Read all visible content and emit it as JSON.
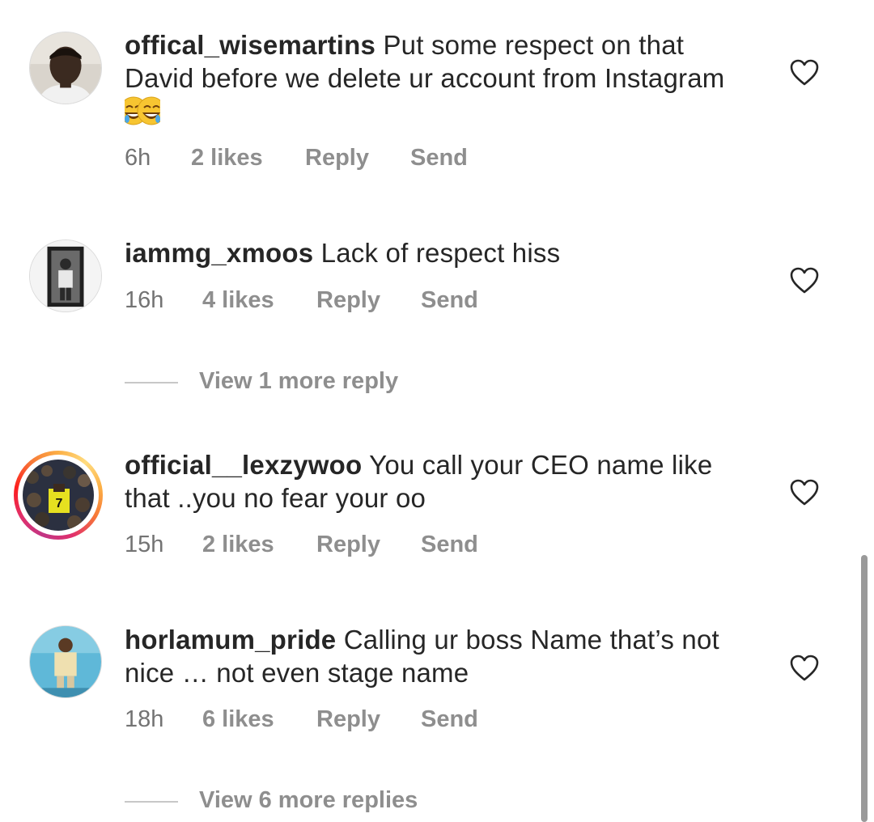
{
  "comments": [
    {
      "username": "offical_wisemartins",
      "text": "Put some respect on that David before we delete ur account from Instagram",
      "emoji": "😂😂",
      "time": "6h",
      "likes": "2 likes",
      "reply": "Reply",
      "send": "Send",
      "avatar_icon": "profile-photo-man",
      "has_story_ring": false
    },
    {
      "username": "iammg_xmoos",
      "text": "Lack of respect hiss",
      "time": "16h",
      "likes": "4 likes",
      "reply": "Reply",
      "send": "Send",
      "avatar_icon": "profile-photo-mirror-selfie",
      "has_story_ring": false,
      "view_replies": "View 1 more reply"
    },
    {
      "username": "official__lexzywoo",
      "text": "You call your CEO name like that ..you no fear your oo",
      "time": "15h",
      "likes": "2 likes",
      "reply": "Reply",
      "send": "Send",
      "avatar_icon": "profile-photo-crowd-jersey",
      "has_story_ring": true
    },
    {
      "username": "horlamum_pride",
      "text": "Calling ur boss Name that’s not nice … not even stage name",
      "time": "18h",
      "likes": "6 likes",
      "reply": "Reply",
      "send": "Send",
      "avatar_icon": "profile-photo-man-standing",
      "has_story_ring": false,
      "view_replies": "View 6 more replies"
    }
  ],
  "colors": {
    "text_primary": "#262626",
    "text_secondary": "#8e8e8e",
    "background": "#ffffff",
    "story_ring_start": "#fcaf45",
    "story_ring_end": "#c13584"
  }
}
